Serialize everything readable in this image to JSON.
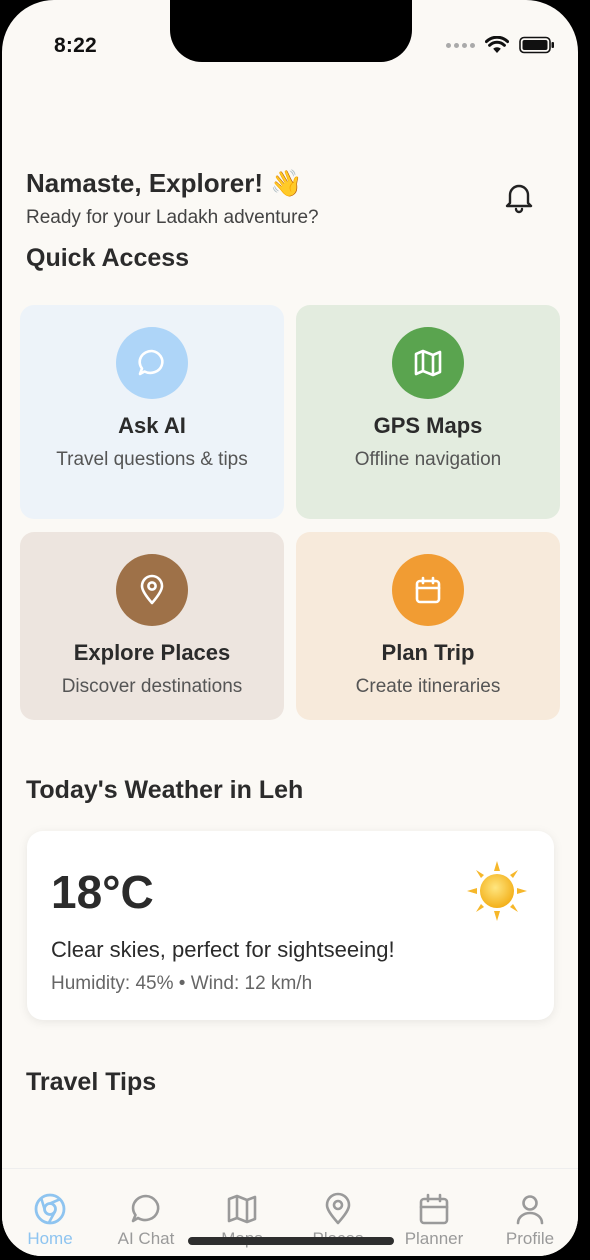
{
  "status_bar": {
    "time": "8:22"
  },
  "header": {
    "greeting": "Namaste, Explorer! 👋",
    "subtitle": "Ready for your Ladakh adventure?",
    "notification_icon": "bell-icon"
  },
  "quick_access": {
    "title": "Quick Access",
    "cards": [
      {
        "title": "Ask AI",
        "subtitle": "Travel questions & tips",
        "icon": "chat-bubble-icon",
        "bg": "#edf3f9",
        "circle": "#aed5f8",
        "icon_color": "#ffffff"
      },
      {
        "title": "GPS Maps",
        "subtitle": "Offline navigation",
        "icon": "map-icon",
        "bg": "#e3ecdf",
        "circle": "#5aa44f",
        "icon_color": "#ffffff"
      },
      {
        "title": "Explore Places",
        "subtitle": "Discover destinations",
        "icon": "map-pin-icon",
        "bg": "#ede5df",
        "circle": "#9e7148",
        "icon_color": "#ffffff"
      },
      {
        "title": "Plan Trip",
        "subtitle": "Create itineraries",
        "icon": "calendar-icon",
        "bg": "#f7eadb",
        "circle": "#f19c33",
        "icon_color": "#ffffff"
      }
    ]
  },
  "weather": {
    "title": "Today's Weather in Leh",
    "temperature": "18°C",
    "description": "Clear skies, perfect for sightseeing!",
    "details": "Humidity: 45% • Wind: 12 km/h",
    "icon": "sun-icon"
  },
  "travel_tips": {
    "title": "Travel Tips"
  },
  "tab_bar": {
    "tabs": [
      {
        "label": "Home",
        "icon": "home-icon",
        "active": true
      },
      {
        "label": "AI Chat",
        "icon": "chat-bubble-icon",
        "active": false
      },
      {
        "label": "Maps",
        "icon": "map-icon",
        "active": false
      },
      {
        "label": "Places",
        "icon": "map-pin-icon",
        "active": false
      },
      {
        "label": "Planner",
        "icon": "calendar-icon",
        "active": false
      },
      {
        "label": "Profile",
        "icon": "user-icon",
        "active": false
      }
    ]
  },
  "colors": {
    "background": "#fbf9f5",
    "active_tab": "#8ec4f0",
    "text": "#2b2b2b"
  }
}
